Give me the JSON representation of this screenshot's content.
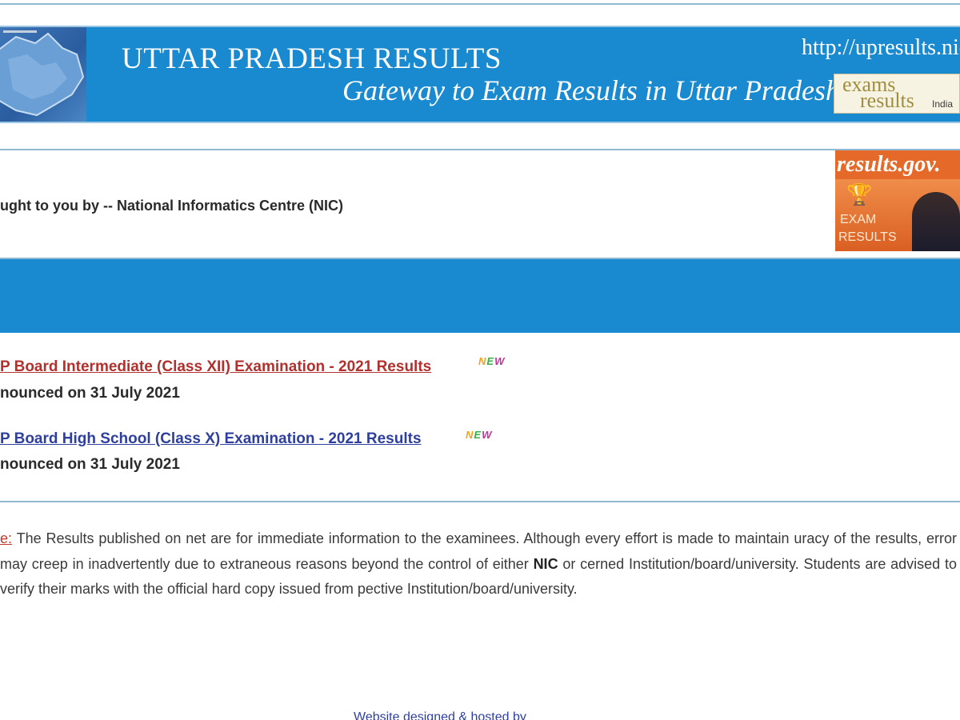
{
  "header": {
    "title": "UTTAR PRADESH RESULTS",
    "tagline": "Gateway to Exam Results in Uttar Pradesh",
    "url": "http://upresults.nic.",
    "exams_logo": {
      "line1": "exams",
      "line2": "results",
      "suffix": "India"
    }
  },
  "credit": {
    "text": "ught to you by -- National Informatics Centre (NIC)"
  },
  "results_gov_logo": {
    "title": "results.gov.",
    "line1": "EXAM",
    "line2": "RESULTS"
  },
  "results": [
    {
      "link": "P Board Intermediate (Class XII) Examination  - 2021 Results",
      "badge": "NEW",
      "announced": "nounced on 31 July 2021"
    },
    {
      "link": "P Board High School (Class X) Examination - 2021 Results",
      "badge": "NEW",
      "announced": "nounced on 31 July 2021"
    }
  ],
  "note": {
    "label": "e:",
    "part1": " The Results published on net are for immediate information to the examinees. Although every effort is made to maintain uracy of the results, error may creep in inadvertently due to extraneous reasons beyond the control of either ",
    "bold": "NIC",
    "part2": " or cerned Institution/board/university. Students are advised to verify their marks with the official hard copy issued from pective Institution/board/university."
  },
  "footer": {
    "text": "Website designed & hosted by"
  },
  "colors": {
    "header_blue": "#1a8ad0",
    "divider": "#8fb8d2",
    "intermediate_link": "#b0312e",
    "high_school_link": "#2e3f9e",
    "note_label": "#c0392b",
    "results_gov_orange": "#e56a2a"
  },
  "icons": {
    "state_map": "up-state-map-icon",
    "trophy": "trophy-icon",
    "graduate": "graduate-figure-icon"
  }
}
